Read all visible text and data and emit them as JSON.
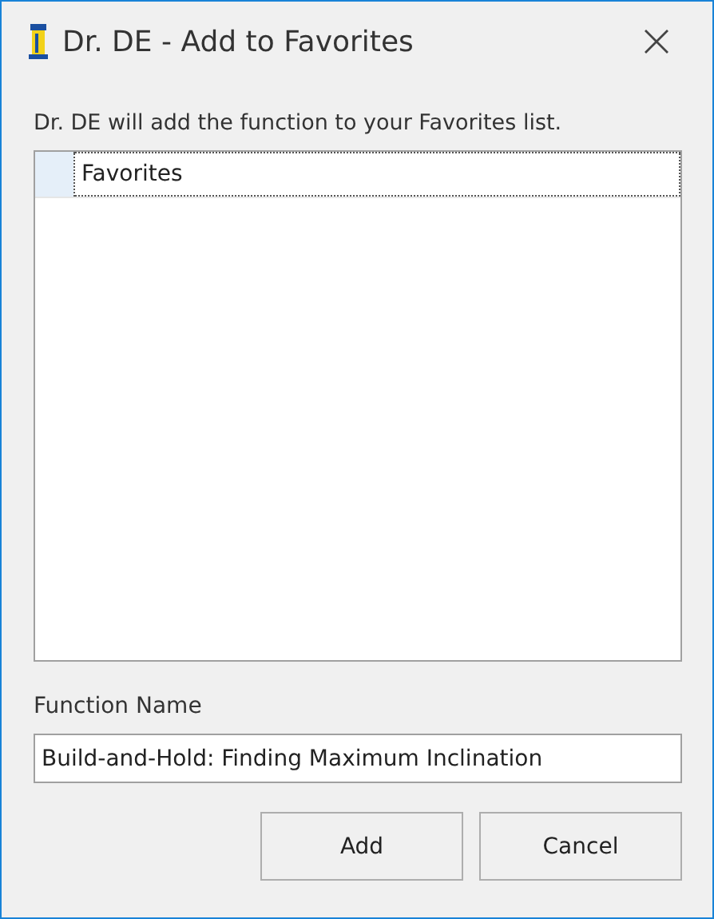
{
  "window": {
    "title": "Dr. DE - Add to Favorites"
  },
  "message": "Dr. DE will add the function to your Favorites list.",
  "list": {
    "items": [
      {
        "label": "Favorites",
        "selected": true
      }
    ]
  },
  "function_name": {
    "label": "Function Name",
    "value": "Build-and-Hold: Finding Maximum Inclination"
  },
  "buttons": [
    "Add",
    "Cancel"
  ]
}
